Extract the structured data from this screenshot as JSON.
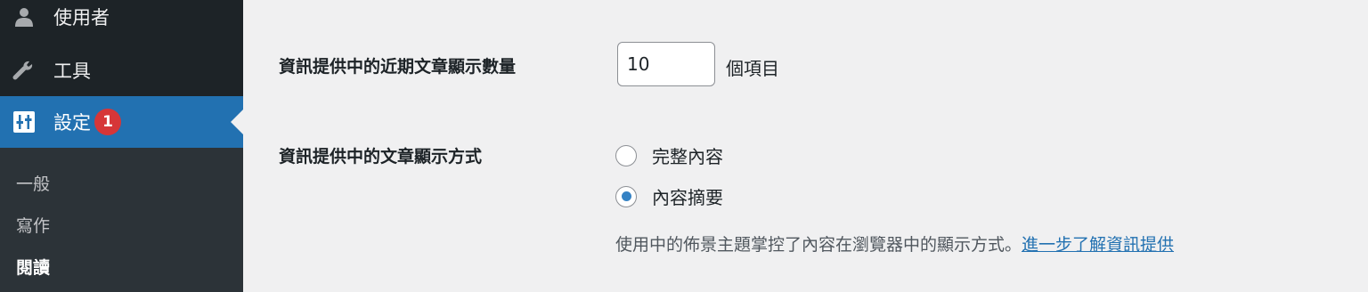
{
  "sidebar": {
    "menu": [
      {
        "label": "使用者",
        "icon": "user-icon"
      },
      {
        "label": "工具",
        "icon": "wrench-icon"
      },
      {
        "label": "設定",
        "icon": "settings-sliders-icon",
        "badge": "1"
      }
    ],
    "submenu": [
      {
        "label": "一般"
      },
      {
        "label": "寫作"
      },
      {
        "label": "閱讀"
      }
    ]
  },
  "form": {
    "posts_label": "資訊提供中的近期文章顯示數量",
    "posts_value": "10",
    "posts_suffix": "個項目",
    "show_label": "資訊提供中的文章顯示方式",
    "options": [
      {
        "label": "完整內容",
        "checked": false
      },
      {
        "label": "內容摘要",
        "checked": true
      }
    ],
    "description": "使用中的佈景主題掌控了內容在瀏覽器中的顯示方式。",
    "learn_more_link": "進一步了解資訊提供"
  },
  "colors": {
    "accent": "#2271b1",
    "sidebar_bg": "#1d2327",
    "badge": "#d63638"
  }
}
